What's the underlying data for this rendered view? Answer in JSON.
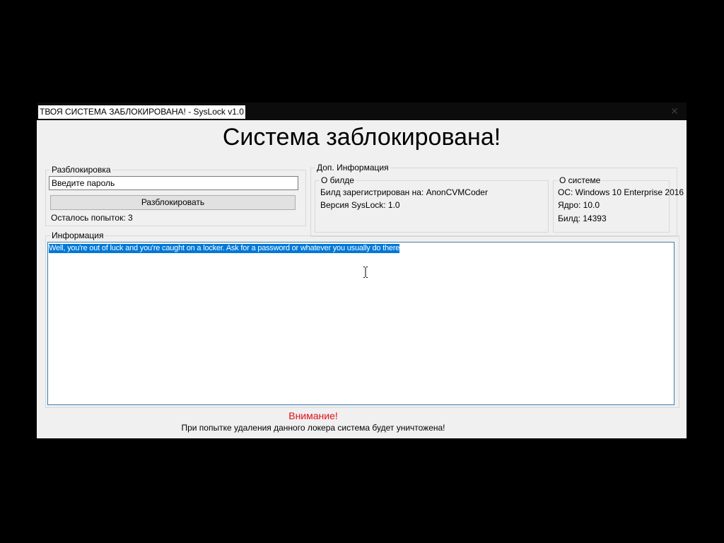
{
  "window": {
    "title": "ТВОЯ СИСТЕМА ЗАБЛОКИРОВАНА! - SysLock v1.0",
    "close_label": "✕"
  },
  "heading": "Система заблокирована!",
  "unlock_group": {
    "legend": "Разблокировка",
    "password_value": "Введите пароль",
    "button_label": "Разблокировать",
    "attempts_text": "Осталось попыток: 3"
  },
  "extra_info": {
    "legend": "Доп. Информация",
    "build": {
      "legend": "О билде",
      "registered": "Билд зарегистрирован на: AnonCVMCoder",
      "version": "Версия SysLock: 1.0"
    },
    "system": {
      "legend": "О системе",
      "os": "ОС: Windows 10 Enterprise 2016",
      "kernel": "Ядро: 10.0",
      "build": "Билд: 14393"
    }
  },
  "info_group": {
    "legend": "Информация",
    "text": "Well, you're out of luck and you're caught on a locker. Ask for a password or whatever you usually do there"
  },
  "warning": {
    "title": "Внимание!",
    "text": "При попытке удаления данного локера система будет уничтожена!"
  },
  "colors": {
    "window_bg": "#f0f0f0",
    "titlebar_bg": "#0c0c0c",
    "selection": "#0078d7",
    "warning": "#e0101a",
    "textbox_border": "#3c7fb1"
  }
}
